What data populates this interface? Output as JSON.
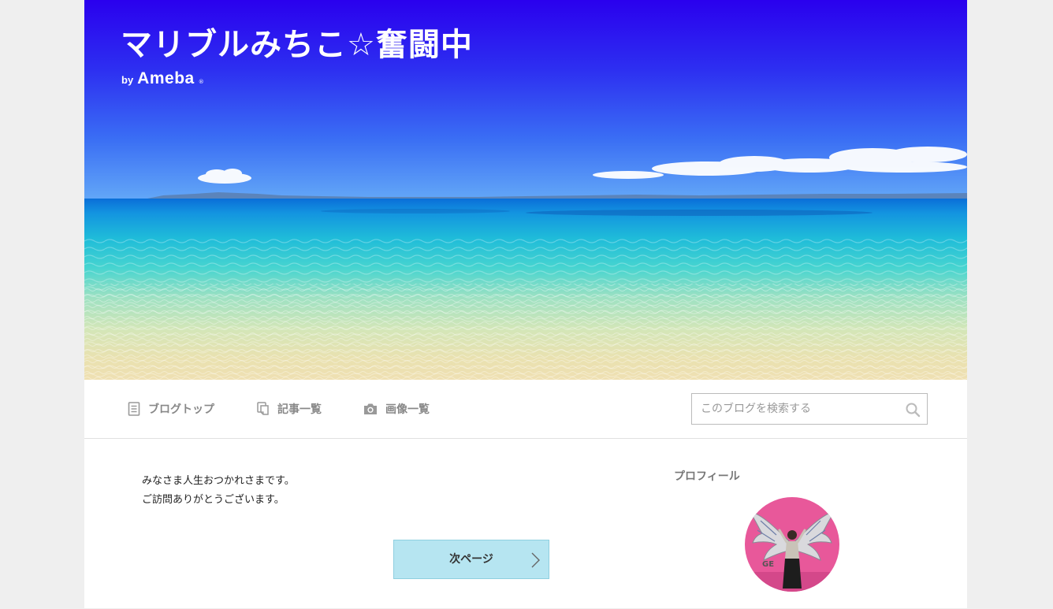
{
  "header": {
    "blog_title": "マリブルみちこ☆奮闘中",
    "by_label": "by",
    "brand_label": "Ameba",
    "brand_mark": "®"
  },
  "nav": {
    "items": [
      {
        "label": "ブログトップ",
        "icon": "document-icon"
      },
      {
        "label": "記事一覧",
        "icon": "copy-icon"
      },
      {
        "label": "画像一覧",
        "icon": "camera-icon"
      }
    ]
  },
  "search": {
    "placeholder": "このブログを検索する",
    "value": ""
  },
  "main": {
    "greeting_line1": "みなさま人生おつかれさまです。",
    "greeting_line2": "ご訪問ありがとうございます。",
    "next_page_label": "次ページ"
  },
  "sidebar": {
    "profile_heading": "プロフィール"
  },
  "colors": {
    "sky_top": "#2a00ee",
    "sea_turquoise": "#23c3d9",
    "next_button_bg": "#b6e5f1",
    "page_bg": "#efefef",
    "avatar_pink": "#e8589a"
  }
}
